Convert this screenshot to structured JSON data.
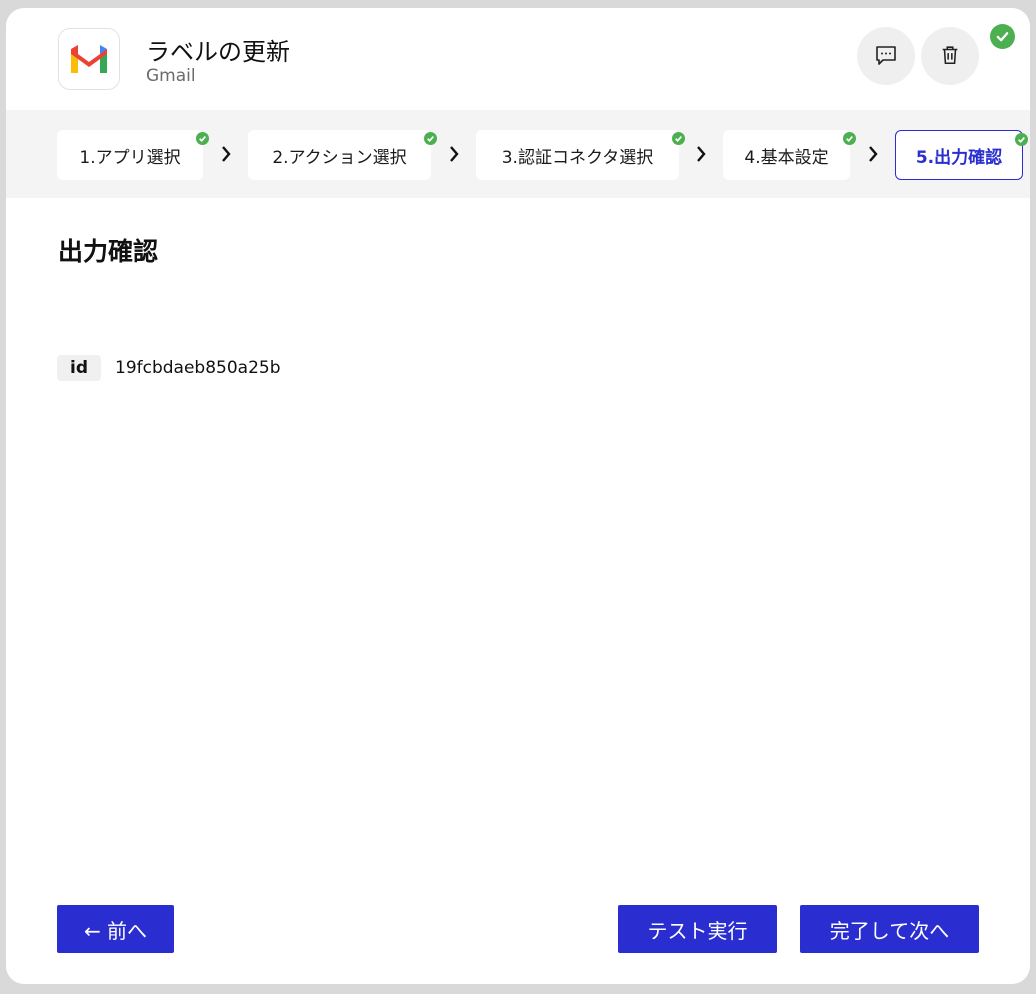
{
  "header": {
    "title": "ラベルの更新",
    "subtitle": "Gmail",
    "logo_icon": "gmail-logo",
    "comment_icon": "comment-icon",
    "trash_icon": "trash-icon",
    "status_icon": "check-circle-icon"
  },
  "steps": [
    {
      "label": "1.アプリ選択",
      "completed": true,
      "active": false
    },
    {
      "label": "2.アクション選択",
      "completed": true,
      "active": false
    },
    {
      "label": "3.認証コネクタ選択",
      "completed": true,
      "active": false
    },
    {
      "label": "4.基本設定",
      "completed": true,
      "active": false
    },
    {
      "label": "5.出力確認",
      "completed": true,
      "active": true
    }
  ],
  "main": {
    "title": "出力確認",
    "outputs": [
      {
        "key": "id",
        "value": "19fcbdaeb850a25b"
      }
    ]
  },
  "footer": {
    "prev_label": "← 前へ",
    "test_label": "テスト実行",
    "next_label": "完了して次へ"
  },
  "colors": {
    "accent": "#2a2ed0",
    "success": "#4caf50",
    "step_bar_bg": "#f4f4f4"
  }
}
